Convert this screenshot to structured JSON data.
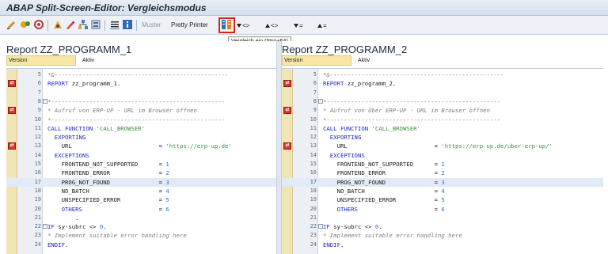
{
  "window": {
    "title": "ABAP Split-Screen-Editor: Vergleichsmodus"
  },
  "toolbar": {
    "muster_label": "Muster",
    "pretty_printer_label": "Pretty Printer",
    "nav_next_label": "<>",
    "nav_prev_label": "<>",
    "nav_down_label": "=",
    "nav_up_label": "=",
    "tooltip": "Vergleich ein   (Strg+F4)"
  },
  "left": {
    "title": "Report ZZ_PROGRAMM_1",
    "version_label": "Version",
    "version_value": "Aktiv",
    "lines": [
      {
        "n": "5",
        "code": "*&--------------------------------------------------",
        "mark": false
      },
      {
        "n": "6",
        "code": "REPORT zz_programm_1.",
        "mark": true
      },
      {
        "n": "7",
        "code": "",
        "mark": false
      },
      {
        "n": "8",
        "code": "*--------------------------------------------------",
        "mark": false
      },
      {
        "n": "9",
        "code": "* Aufruf von ERP-UP - URL im Browser öffnen",
        "mark": true
      },
      {
        "n": "10",
        "code": "*--------------------------------------------------",
        "mark": false
      },
      {
        "n": "11",
        "code": "CALL FUNCTION 'CALL_BROWSER'",
        "mark": false
      },
      {
        "n": "12",
        "code": "  EXPORTING",
        "mark": false
      },
      {
        "n": "13",
        "code": "    URL                         = 'https://erp-up.de'",
        "mark": true
      },
      {
        "n": "14",
        "code": "  EXCEPTIONS",
        "mark": false
      },
      {
        "n": "15",
        "code": "    FRONTEND_NOT_SUPPORTED      = 1",
        "mark": false
      },
      {
        "n": "16",
        "code": "    FRONTEND_ERROR              = 2",
        "mark": false
      },
      {
        "n": "17",
        "code": "    PROG_NOT_FOUND              = 3",
        "mark": false
      },
      {
        "n": "18",
        "code": "    NO_BATCH                    = 4",
        "mark": false
      },
      {
        "n": "19",
        "code": "    UNSPECIFIED_ERROR           = 5",
        "mark": false
      },
      {
        "n": "20",
        "code": "    OTHERS                      = 6",
        "mark": false
      },
      {
        "n": "21",
        "code": "        .",
        "mark": false
      },
      {
        "n": "22",
        "code": "IF sy-subrc <> 0.",
        "mark": false
      },
      {
        "n": "23",
        "code": "* Implement suitable error handling here",
        "mark": false
      },
      {
        "n": "24",
        "code": "ENDIF.",
        "mark": false
      }
    ]
  },
  "right": {
    "title": "Report ZZ_PROGRAMM_2",
    "version_label": "Version",
    "version_value": "Aktiv",
    "lines": [
      {
        "n": "5",
        "code": "*&--------------------------------------------------",
        "mark": false
      },
      {
        "n": "6",
        "code": "REPORT zz_programm_2.",
        "mark": true
      },
      {
        "n": "7",
        "code": "",
        "mark": false
      },
      {
        "n": "8",
        "code": "*--------------------------------------------------",
        "mark": false
      },
      {
        "n": "9",
        "code": "* Aufruf von Über ERP-UP - URL im Browser öffnen",
        "mark": true
      },
      {
        "n": "10",
        "code": "*--------------------------------------------------",
        "mark": false
      },
      {
        "n": "11",
        "code": "CALL FUNCTION 'CALL_BROWSER'",
        "mark": false
      },
      {
        "n": "12",
        "code": "  EXPORTING",
        "mark": false
      },
      {
        "n": "13",
        "code": "    URL                         = 'https://erp-up.de/uber-erp-up/'",
        "mark": true
      },
      {
        "n": "14",
        "code": "  EXCEPTIONS",
        "mark": false
      },
      {
        "n": "15",
        "code": "    FRONTEND_NOT_SUPPORTED      = 1",
        "mark": false
      },
      {
        "n": "16",
        "code": "    FRONTEND_ERROR              = 2",
        "mark": false
      },
      {
        "n": "17",
        "code": "    PROG_NOT_FOUND              = 3",
        "mark": false
      },
      {
        "n": "18",
        "code": "    NO_BATCH                    = 4",
        "mark": false
      },
      {
        "n": "19",
        "code": "    UNSPECIFIED_ERROR           = 5",
        "mark": false
      },
      {
        "n": "20",
        "code": "    OTHERS                      = 6",
        "mark": false
      },
      {
        "n": "21",
        "code": "",
        "mark": false
      },
      {
        "n": "22",
        "code": "IF sy-subrc <> 0.",
        "mark": false
      },
      {
        "n": "23",
        "code": "* Implement suitable error handling here",
        "mark": false
      },
      {
        "n": "24",
        "code": "ENDIF.",
        "mark": false
      }
    ]
  }
}
